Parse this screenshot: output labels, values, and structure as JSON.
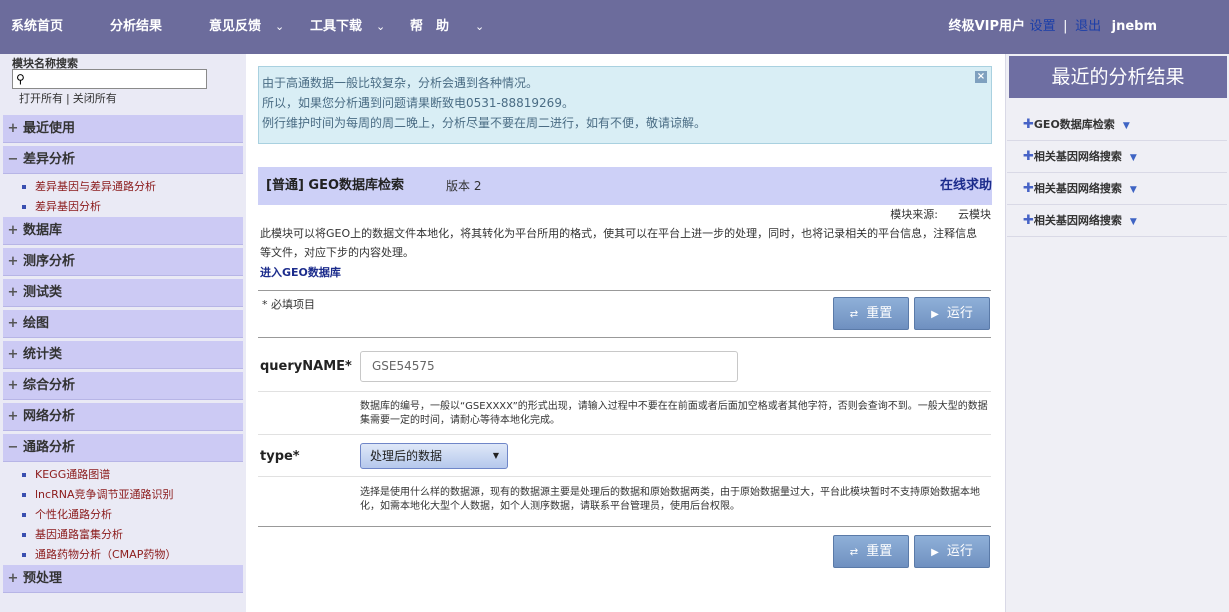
{
  "topbar": {
    "nav": [
      "系统首页",
      "分析结果",
      "意见反馈",
      "工具下载",
      "帮　助"
    ],
    "dropdown_icon": "chevron-down-icon",
    "user_prefix": "终极VIP用户",
    "settings": "设置",
    "separator": "|",
    "logout": "退出",
    "username": "jnebm"
  },
  "sidebar": {
    "search_label": "模块名称搜索",
    "search_value": "",
    "open_all": "打开所有",
    "close_all": "关闭所有",
    "separator": "|",
    "groups": [
      {
        "sign": "+",
        "label": "最近使用"
      },
      {
        "sign": "−",
        "label": "差异分析",
        "items": [
          "差异基因与差异通路分析",
          "差异基因分析"
        ]
      },
      {
        "sign": "+",
        "label": "数据库"
      },
      {
        "sign": "+",
        "label": "测序分析"
      },
      {
        "sign": "+",
        "label": "测试类"
      },
      {
        "sign": "+",
        "label": "绘图"
      },
      {
        "sign": "+",
        "label": "统计类"
      },
      {
        "sign": "+",
        "label": "综合分析"
      },
      {
        "sign": "+",
        "label": "网络分析"
      },
      {
        "sign": "−",
        "label": "通路分析",
        "items": [
          "KEGG通路图谱",
          "lncRNA竞争调节亚通路识别",
          "个性化通路分析",
          "基因通路富集分析",
          "通路药物分析（CMAP药物）"
        ]
      },
      {
        "sign": "+",
        "label": "预处理"
      }
    ]
  },
  "notice": {
    "lines": [
      "由于高通数据一般比较复杂，分析会遇到各种情况。",
      "所以，如果您分析遇到问题请果断致电0531-88819269。",
      "例行维护时间为每周的周二晚上，分析尽量不要在周二进行，如有不便，敬请谅解。"
    ],
    "close_glyph": "×"
  },
  "module": {
    "title": "[普通] GEO数据库检索",
    "version": "版本 2",
    "help": "在线求助",
    "source_label": "模块来源:",
    "source_value": "云模块",
    "description": "此模块可以将GEO上的数据文件本地化，将其转化为平台所用的格式，使其可以在平台上进一步的处理，同时，也将记录相关的平台信息，注释信息等文件，对应下步的内容处理。",
    "enter_link": "进入GEO数据库",
    "required_note": "* 必填项目",
    "reset": "重置",
    "run": "运行",
    "fields": {
      "query": {
        "label": "queryNAME*",
        "value": "GSE54575",
        "help": "数据库的编号，一般以“GSEXXXX”的形式出现，请输入过程中不要在在前面或者后面加空格或者其他字符，否则会查询不到。一般大型的数据集需要一定的时间，请耐心等待本地化完成。"
      },
      "type": {
        "label": "type*",
        "selected": "处理后的数据",
        "help": "选择是使用什么样的数据源，现有的数据源主要是处理后的数据和原始数据两类，由于原始数据量过大，平台此模块暂时不支持原始数据本地化，如需本地化大型个人数据，如个人测序数据，请联系平台管理员，使用后台权限。"
      }
    }
  },
  "right": {
    "title": "最近的分析结果",
    "items": [
      "GEO数据库检索",
      "相关基因网络搜索",
      "相关基因网络搜索",
      "相关基因网络搜索"
    ]
  },
  "colors": {
    "topbar": "#6c6c9c",
    "sidebar_group": "#cccaf4",
    "title_bar": "#cdd0f7",
    "button": "#7f9fcc",
    "link": "#1c2c8c"
  }
}
